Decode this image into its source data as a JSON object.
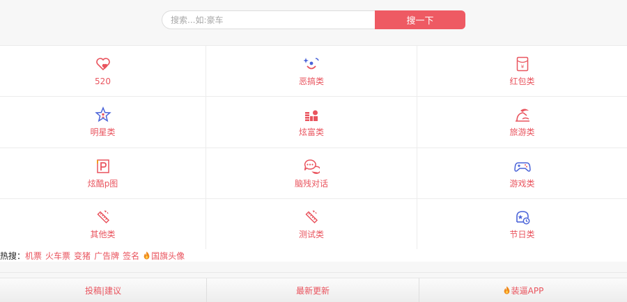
{
  "search": {
    "placeholder": "搜索...如:豪车",
    "value": "",
    "button_label": "搜一下"
  },
  "categories": [
    {
      "label": "520",
      "icon": "heart-icon"
    },
    {
      "label": "恶搞类",
      "icon": "clown-face-icon"
    },
    {
      "label": "红包类",
      "icon": "red-envelope-icon"
    },
    {
      "label": "明星类",
      "icon": "star-icon"
    },
    {
      "label": "炫富类",
      "icon": "coins-icon"
    },
    {
      "label": "旅游类",
      "icon": "beach-icon"
    },
    {
      "label": "炫酷p图",
      "icon": "photo-p-icon"
    },
    {
      "label": "脑残对话",
      "icon": "chat-bubbles-icon"
    },
    {
      "label": "游戏类",
      "icon": "gamepad-icon"
    },
    {
      "label": "其他类",
      "icon": "ruler-icon"
    },
    {
      "label": "测试类",
      "icon": "ruler-icon"
    },
    {
      "label": "节日类",
      "icon": "holiday-icon"
    }
  ],
  "hot_search": {
    "prefix": "热搜：",
    "links": [
      "机票",
      "火车票",
      "变猪",
      "广告牌",
      "签名",
      "国旗头像"
    ]
  },
  "footer": {
    "items": [
      "投稿|建议",
      "最新更新",
      "装逼APP"
    ]
  },
  "colors": {
    "accent": "#ee5a63",
    "label_red": "#e9545e",
    "icon_blue": "#4a63d8"
  }
}
